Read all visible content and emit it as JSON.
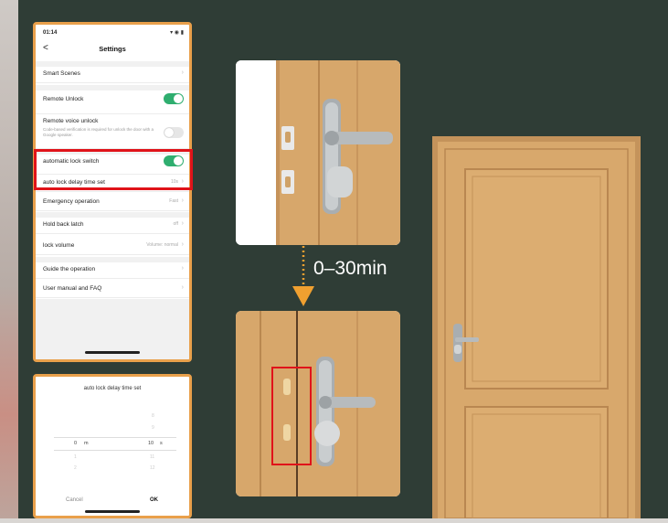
{
  "settings": {
    "status_time": "01:14",
    "status_icons": "▾ ◉ ▮",
    "back": "<",
    "title": "Settings",
    "rows": {
      "smart_scenes": "Smart Scenes",
      "remote_unlock": "Remote Unlock",
      "remote_voice_unlock": "Remote voice unlock",
      "remote_voice_sub": "Code-based verification is required for unlock the door with a Google speaker.",
      "auto_lock_switch": "automatic lock switch",
      "auto_lock_delay": "auto lock delay time set",
      "auto_lock_delay_value": "10s",
      "emergency_operation": "Emergency operation",
      "emergency_value": "Fast",
      "hold_back_latch": "Hold back latch",
      "hold_back_value": "off",
      "lock_volume": "lock volume",
      "lock_volume_value": "Volume: normal",
      "guide": "Guide the operation",
      "manual": "User manual and FAQ"
    },
    "toggles": {
      "remote_unlock": true,
      "remote_voice_unlock": false,
      "auto_lock_switch": true
    }
  },
  "picker": {
    "title": "auto lock delay time set",
    "minutes_value": "0",
    "minutes_unit": "m",
    "seconds_value": "10",
    "seconds_unit": "s",
    "above": [
      "8",
      "9"
    ],
    "below": [
      "1",
      "2"
    ],
    "below_s": [
      "11",
      "12"
    ],
    "cancel": "Cancel",
    "ok": "OK"
  },
  "diagram": {
    "range_label": "0–30min"
  },
  "colors": {
    "board": "#2f3d36",
    "phone_border": "#e9a04b",
    "toggle_on": "#2fae6f",
    "highlight": "#e0131a",
    "arrow": "#f0a030",
    "wood": "#d6a56a"
  }
}
